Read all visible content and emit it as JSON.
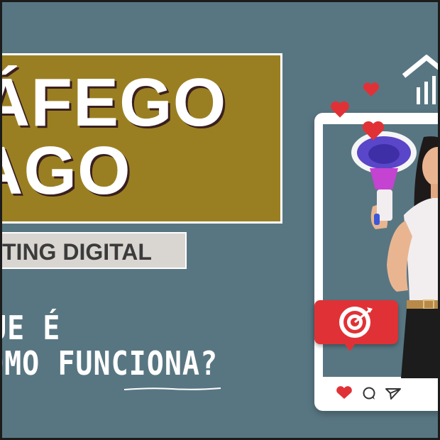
{
  "title": {
    "line1": "ÁFEGO",
    "line2": "AGO",
    "subtitle": "TING DIGITAL"
  },
  "question": {
    "line1": "UE É",
    "line2": "OMO FUNCIONA?"
  },
  "colors": {
    "background": "#587682",
    "title_box": "#9a7f22",
    "subtitle_box": "#d9d5d1",
    "accent_red": "#e03236",
    "white": "#ffffff"
  },
  "icons": [
    "heart-icon",
    "comment-icon",
    "send-icon",
    "target-icon",
    "megaphone-icon",
    "house-icon"
  ]
}
